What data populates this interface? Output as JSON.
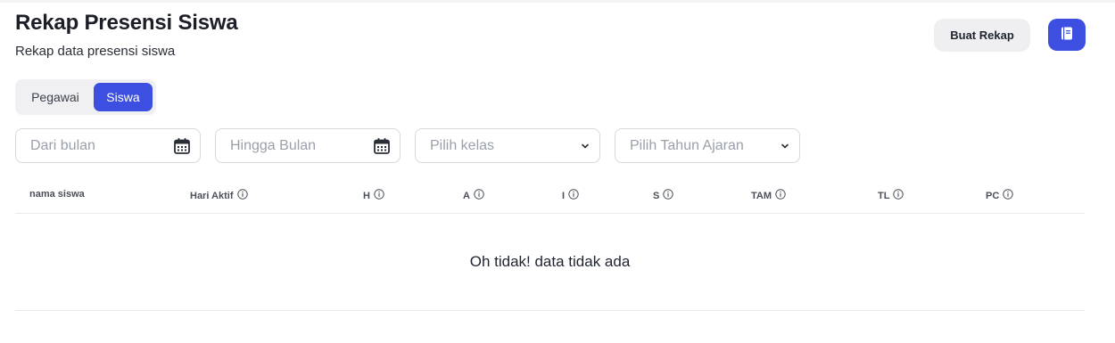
{
  "header": {
    "title": "Rekap Presensi Siswa",
    "subtitle": "Rekap data presensi siswa",
    "create_button": "Buat Rekap",
    "book_icon": "book-icon"
  },
  "toggle": {
    "options": [
      "Pegawai",
      "Siswa"
    ],
    "selected": "Siswa"
  },
  "filters": {
    "from_month": {
      "placeholder": "Dari bulan",
      "icon": "calendar-icon"
    },
    "to_month": {
      "placeholder": "Hingga Bulan",
      "icon": "calendar-icon"
    },
    "class": {
      "placeholder": "Pilih kelas",
      "icon": "chevron-down-icon"
    },
    "school_year": {
      "placeholder": "Pilih Tahun Ajaran",
      "icon": "chevron-down-icon"
    }
  },
  "table": {
    "columns": [
      {
        "label": "nama siswa",
        "info": false
      },
      {
        "label": "Hari Aktif",
        "info": true
      },
      {
        "label": "H",
        "info": true
      },
      {
        "label": "A",
        "info": true
      },
      {
        "label": "I",
        "info": true
      },
      {
        "label": "S",
        "info": true
      },
      {
        "label": "TAM",
        "info": true
      },
      {
        "label": "TL",
        "info": true
      },
      {
        "label": "PC",
        "info": true
      }
    ],
    "empty_message": "Oh tidak! data tidak ada"
  },
  "colors": {
    "accent": "#3c4fe0",
    "button_gray": "#efeff1",
    "border": "#d6d9de",
    "placeholder": "#9aa0aa"
  }
}
